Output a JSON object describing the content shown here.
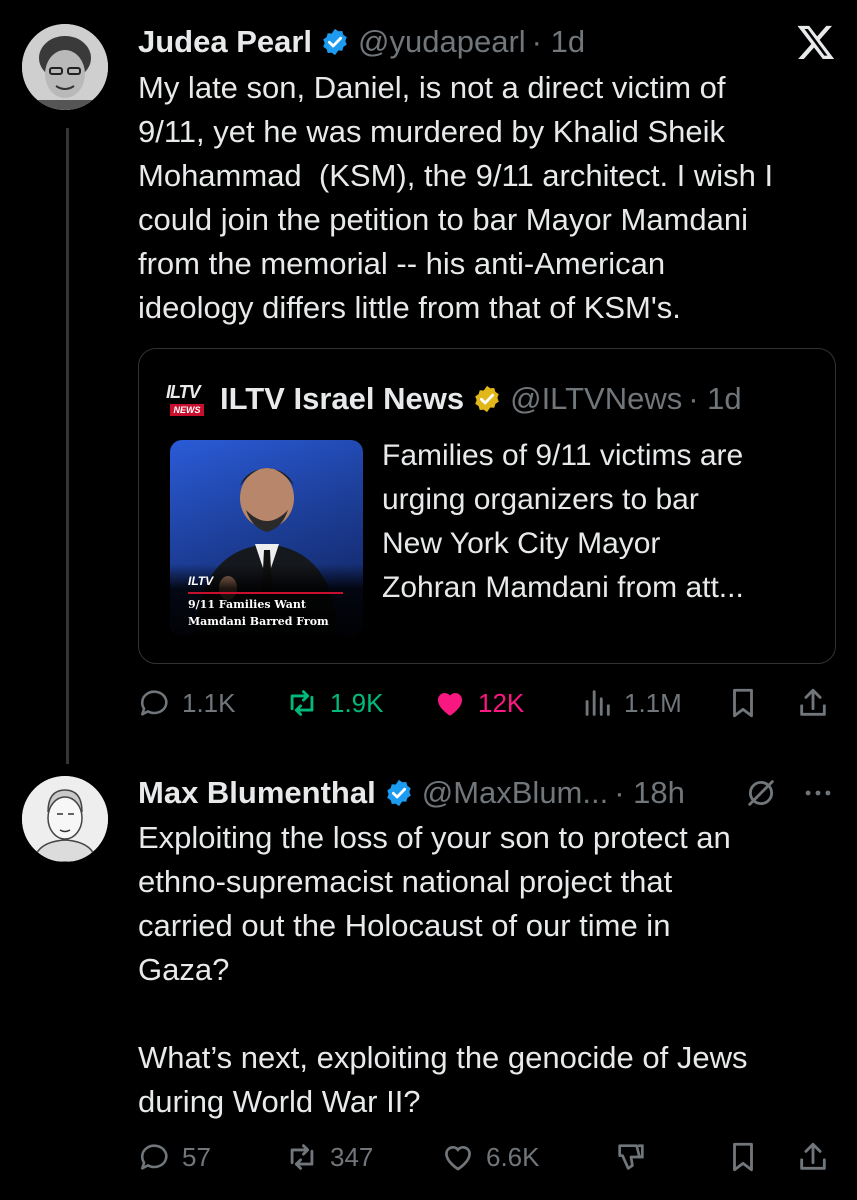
{
  "tweet1": {
    "author": "Judea Pearl",
    "handle": "@yudapearl",
    "time": "· 1d",
    "lines": [
      "My late son, Daniel, is not a direct victim of",
      "9/11, yet he was murdered by Khalid Sheik",
      "Mohammad  (KSM), the 9/11 architect. I wish I",
      "could join the petition to bar Mayor Mamdani",
      "from the memorial -- his anti-American",
      "ideology differs little from that of KSM's."
    ],
    "platform_logo": "X",
    "quote": {
      "logo_text": "ILTV",
      "logo_sub": "NEWS",
      "author": "ILTV Israel News",
      "handle": "@ILTVNews",
      "time": "· 1d",
      "lines": [
        "Families of 9/11 victims are",
        "urging organizers to bar",
        "New York City Mayor",
        "Zohran Mamdani from att..."
      ],
      "thumb_brand": "ILTV",
      "thumb_caption_1": "9/11 Families Want",
      "thumb_caption_2": "Mamdani Barred From"
    },
    "stats": {
      "replies": "1.1K",
      "reposts": "1.9K",
      "likes": "12K",
      "views": "1.1M"
    }
  },
  "tweet2": {
    "author": "Max Blumenthal",
    "handle": "@MaxBlum...",
    "time": "· 18h",
    "lines": [
      "Exploiting the loss of your son to protect an",
      "ethno-supremacist national project that",
      "carried out the Holocaust of our time in",
      "Gaza?",
      "",
      "What’s next, exploiting the genocide of Jews",
      "during World War II?"
    ],
    "stats": {
      "replies": "57",
      "reposts": "347",
      "likes": "6.6K"
    }
  },
  "colors": {
    "background": "#000000",
    "text": "#e7e9ea",
    "muted": "#71767b",
    "verified_blue": "#1d9bf0",
    "verified_gold": "#e2b719",
    "repost_green": "#00ba7c",
    "like_pink": "#f91880"
  }
}
